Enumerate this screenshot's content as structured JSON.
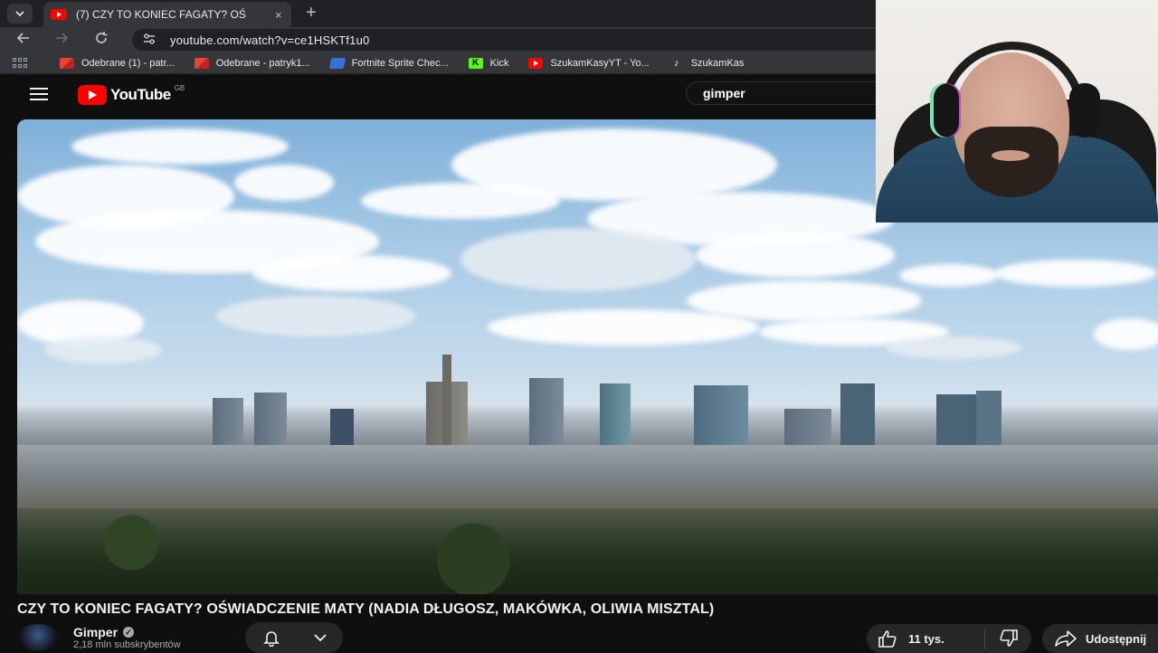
{
  "browser": {
    "tab_title": "(7) CZY TO KONIEC FAGATY? OŚ",
    "tab_close": "×",
    "new_tab": "+",
    "url": "youtube.com/watch?v=ce1HSKTf1u0",
    "bookmarks": [
      {
        "label": "Odebrane (1) - patr...",
        "icon": "gmail-icon"
      },
      {
        "label": "Odebrane - patryk1...",
        "icon": "gmail-icon"
      },
      {
        "label": "Fortnite Sprite Chec...",
        "icon": "fortnite-icon"
      },
      {
        "label": "Kick",
        "icon": "kick-icon"
      },
      {
        "label": "SzukamKasyYT - Yo...",
        "icon": "youtube-icon"
      },
      {
        "label": "SzukamKas",
        "icon": "tiktok-icon"
      }
    ]
  },
  "youtube": {
    "logo_text": "YouTube",
    "region": "GB",
    "search_query": "gimper"
  },
  "video": {
    "title": "CZY TO KONIEC FAGATY? OŚWIADCZENIE MATY (NADIA DŁUGOSZ, MAKÓWKA, OLIWIA MISZTAL)",
    "channel_name": "Gimper",
    "subscribers": "2,18 mln subskrybentów",
    "likes": "11 tys.",
    "share_label": "Udostępnij"
  },
  "colors": {
    "accent": "#ff0000",
    "background": "#0f0f0f",
    "chrome_tab": "#35363a"
  }
}
